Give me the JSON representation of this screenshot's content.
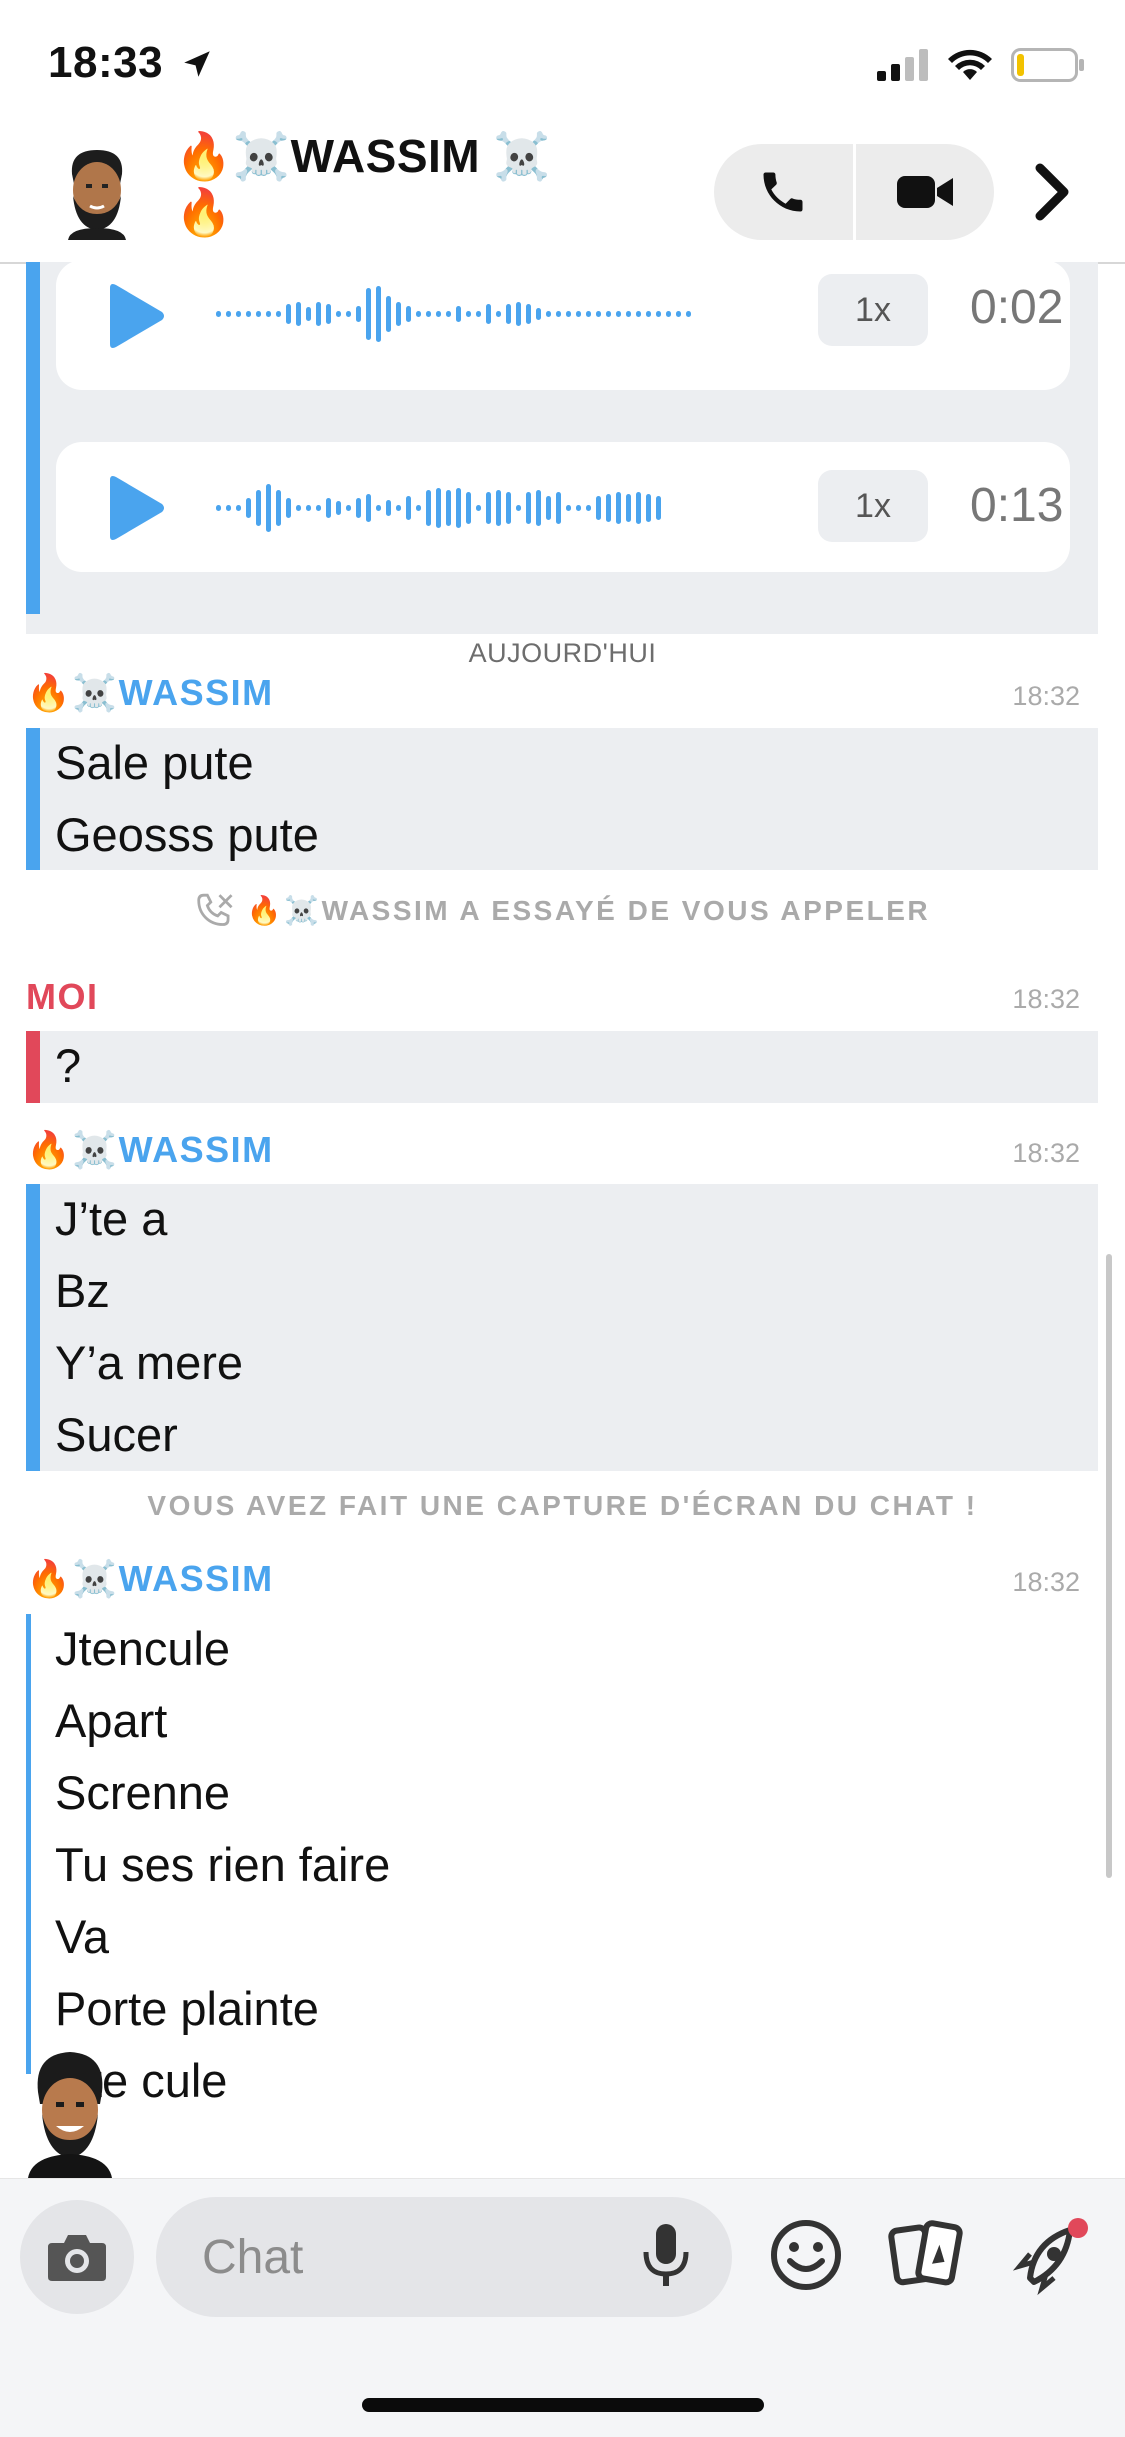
{
  "status": {
    "time": "18:33"
  },
  "header": {
    "title_prefix": "🔥☠️",
    "title": "WASSIM",
    "title_suffix": "☠️",
    "title_tail": "🔥"
  },
  "voice_notes": [
    {
      "speed": "1x",
      "duration": "0:02"
    },
    {
      "speed": "1x",
      "duration": "0:13"
    }
  ],
  "date_separator": "AUJOURD'HUI",
  "groups": [
    {
      "prefix": "🔥☠️",
      "sender": "WASSIM",
      "time": "18:32",
      "messages": [
        "Sale pute",
        "Geosss pute"
      ]
    },
    {
      "sender": "MOI",
      "time": "18:32",
      "messages": [
        "?"
      ]
    },
    {
      "prefix": "🔥☠️",
      "sender": "WASSIM",
      "time": "18:32",
      "messages": [
        "J’te a",
        "Bz",
        "Y’a mere",
        "Sucer"
      ]
    },
    {
      "prefix": "🔥☠️",
      "sender": "WASSIM",
      "time": "18:32",
      "messages": [
        "Jtencule",
        "Apart",
        "Screnne",
        "Tu ses rien faire",
        "Va",
        "Porte plainte",
        "Nte cule"
      ]
    }
  ],
  "system": {
    "missed_call_prefix": "🔥☠️",
    "missed_call": "WASSIM A ESSAYÉ DE VOUS APPELER",
    "screenshot": "VOUS AVEZ FAIT UNE CAPTURE D'ÉCRAN DU CHAT !"
  },
  "composer": {
    "placeholder": "Chat"
  },
  "colors": {
    "them": "#4aa4ee",
    "me": "#e1485a",
    "bubble": "#eceef1"
  }
}
